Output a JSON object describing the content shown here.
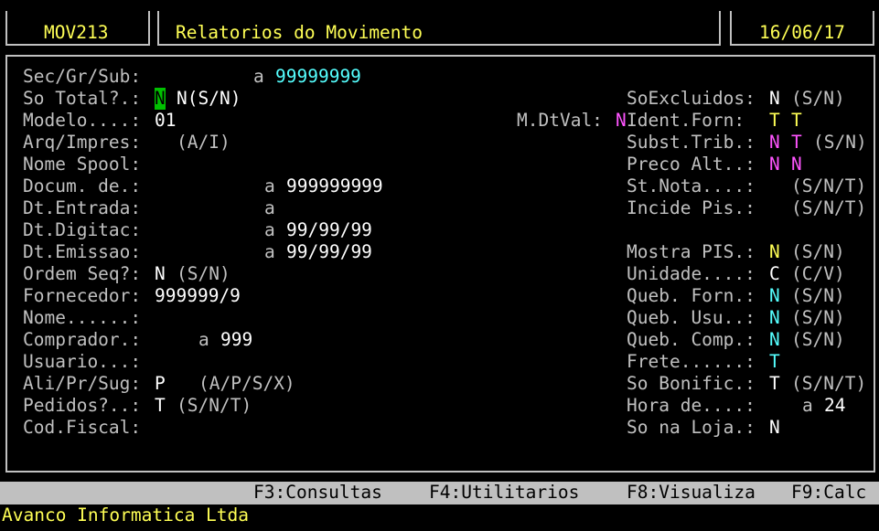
{
  "header": {
    "program": "MOV213",
    "title": "Relatorios do Movimento",
    "date": "16/06/17"
  },
  "left": {
    "secgrsub": {
      "label": "Sec/Gr/Sub:",
      "sep": "a",
      "to": "99999999"
    },
    "sototal": {
      "label": "So Total?.:",
      "cursor": "N",
      "value": "N(S/N)"
    },
    "modelo": {
      "label": "Modelo....:",
      "value": "01"
    },
    "arqimpres": {
      "label": "Arq/Impres:",
      "hint": "(A/I)"
    },
    "nomespool": {
      "label": "Nome Spool:"
    },
    "docum": {
      "label": "Docum. de.:",
      "sep": "a",
      "to": "999999999"
    },
    "dtentrada": {
      "label": "Dt.Entrada:",
      "sep": "a"
    },
    "dtdigitac": {
      "label": "Dt.Digitac:",
      "sep": "a",
      "to": "99/99/99"
    },
    "dtemissao": {
      "label": "Dt.Emissao:",
      "sep": "a",
      "to": "99/99/99"
    },
    "ordemseq": {
      "label": "Ordem Seq?:",
      "value": "N",
      "hint": "(S/N)"
    },
    "fornecedor": {
      "label": "Fornecedor:",
      "value": "999999/9"
    },
    "nome": {
      "label": "Nome......:"
    },
    "comprador": {
      "label": "Comprador.:",
      "sep": "a",
      "to": "999"
    },
    "usuario": {
      "label": "Usuario...:"
    },
    "aliprsug": {
      "label": "Ali/Pr/Sug:",
      "value": "P",
      "hint": "(A/P/S/X)"
    },
    "pedidos": {
      "label": "Pedidos?..:",
      "value": "T",
      "hint": "(S/N/T)"
    },
    "codfiscal": {
      "label": "Cod.Fiscal:"
    }
  },
  "middle": {
    "mdtval": {
      "label": "M.DtVal:",
      "value": "N"
    }
  },
  "right": {
    "soexcluidos": {
      "label": "SoExcluidos:",
      "value": "N",
      "hint": "(S/N)"
    },
    "identforn": {
      "label": "Ident.Forn:",
      "v1": "T",
      "v2": "T"
    },
    "substtrib": {
      "label": "Subst.Trib.:",
      "v1": "N",
      "v2": "T",
      "hint": "(S/N)"
    },
    "precoalt": {
      "label": "Preco Alt..:",
      "v1": "N",
      "v2": "N"
    },
    "stnota": {
      "label": "St.Nota....:",
      "hint": "(S/N/T)"
    },
    "incidepis": {
      "label": "Incide Pis.:",
      "hint": "(S/N/T)"
    },
    "mostrapis": {
      "label": "Mostra PIS.:",
      "value": "N",
      "hint": "(S/N)"
    },
    "unidade": {
      "label": "Unidade....:",
      "value": "C",
      "hint": "(C/V)"
    },
    "quebforn": {
      "label": "Queb. Forn.:",
      "value": "N",
      "hint": "(S/N)"
    },
    "quebusu": {
      "label": "Queb. Usu..:",
      "value": "N",
      "hint": "(S/N)"
    },
    "quebcomp": {
      "label": "Queb. Comp.:",
      "value": "N",
      "hint": "(S/N)"
    },
    "frete": {
      "label": "Frete......:",
      "value": "T"
    },
    "sobonific": {
      "label": "So Bonific.:",
      "value": "T",
      "hint": "(S/N/T)"
    },
    "horade": {
      "label": "Hora de....:",
      "sep": "a",
      "to": "24"
    },
    "sonaloja": {
      "label": "So na Loja.:",
      "value": "N"
    }
  },
  "fkeys": {
    "f3": "F3:Consultas",
    "f4": "F4:Utilitarios",
    "f8": "F8:Visualiza",
    "f9": "F9:Calc"
  },
  "footer": "Avanco Informatica Ltda"
}
